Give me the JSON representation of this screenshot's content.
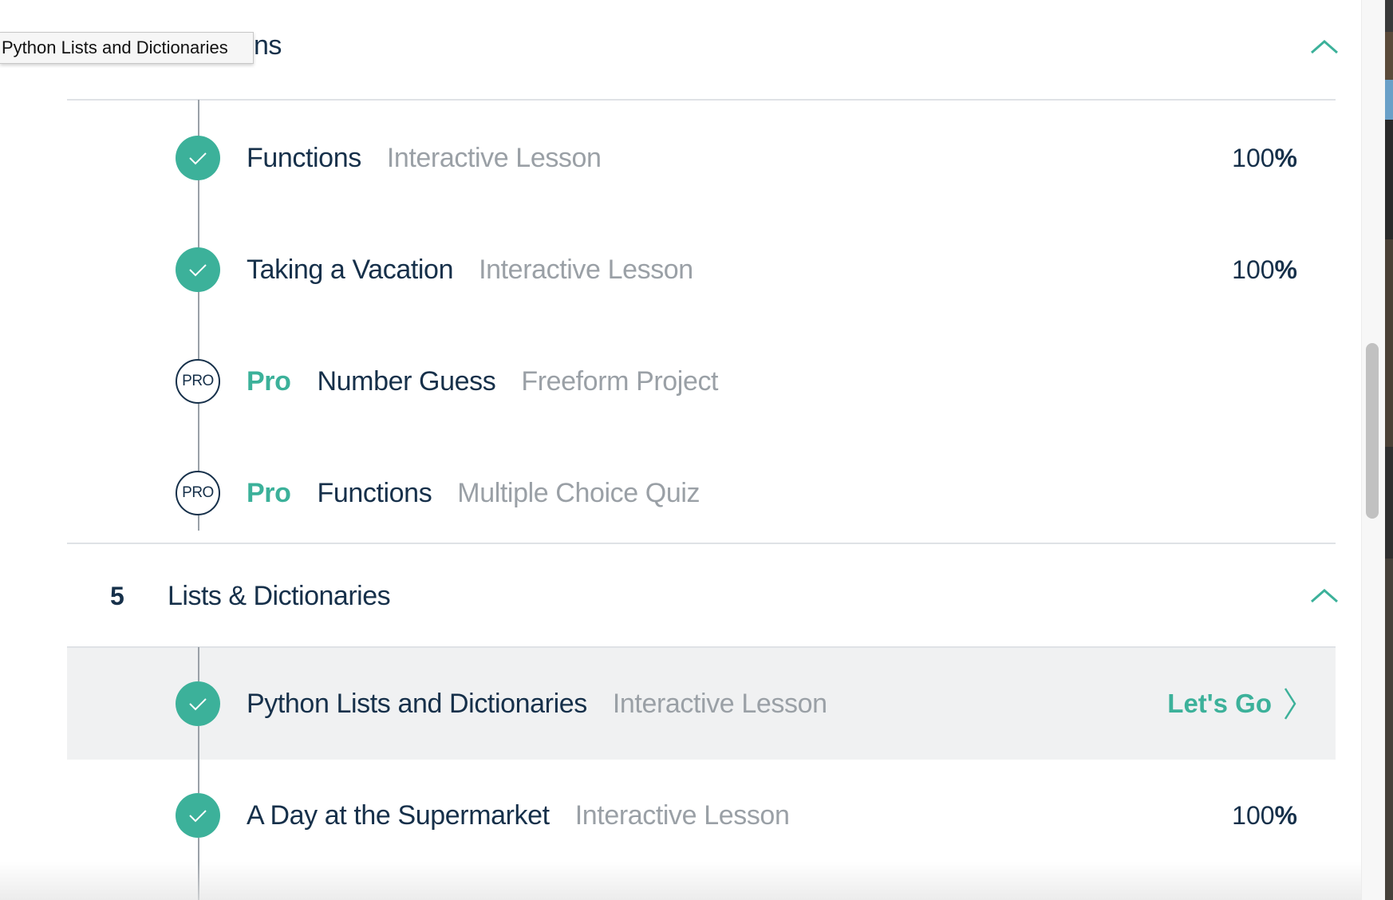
{
  "tooltip": {
    "text": "Python Lists and Dictionaries"
  },
  "section_prev": {
    "title_visible_fragment": "ns"
  },
  "section_prev_items": [
    {
      "status": "done",
      "name": "Functions",
      "type": "Interactive Lesson",
      "progress_number": "100",
      "progress_sign": "%"
    },
    {
      "status": "done",
      "name": "Taking a Vacation",
      "type": "Interactive Lesson",
      "progress_number": "100",
      "progress_sign": "%"
    },
    {
      "status": "pro",
      "badge": "PRO",
      "pro_label": "Pro",
      "name": "Number Guess",
      "type": "Freeform Project"
    },
    {
      "status": "pro",
      "badge": "PRO",
      "pro_label": "Pro",
      "name": "Functions",
      "type": "Multiple Choice Quiz"
    }
  ],
  "section_5": {
    "number": "5",
    "title": "Lists & Dictionaries"
  },
  "section_5_items": [
    {
      "status": "done",
      "active": true,
      "name": "Python Lists and Dictionaries",
      "type": "Interactive Lesson",
      "action": "Let's Go"
    },
    {
      "status": "done",
      "name": "A Day at the Supermarket",
      "type": "Interactive Lesson",
      "progress_number": "100",
      "progress_sign": "%"
    }
  ],
  "colors": {
    "accent": "#3cb19a",
    "text": "#16304a",
    "muted": "#9aa0a6",
    "active_row": "#f0f1f2"
  },
  "icons": {
    "done": "checkmark-icon",
    "collapse": "chevron-up-icon",
    "action": "chevron-right-icon"
  }
}
